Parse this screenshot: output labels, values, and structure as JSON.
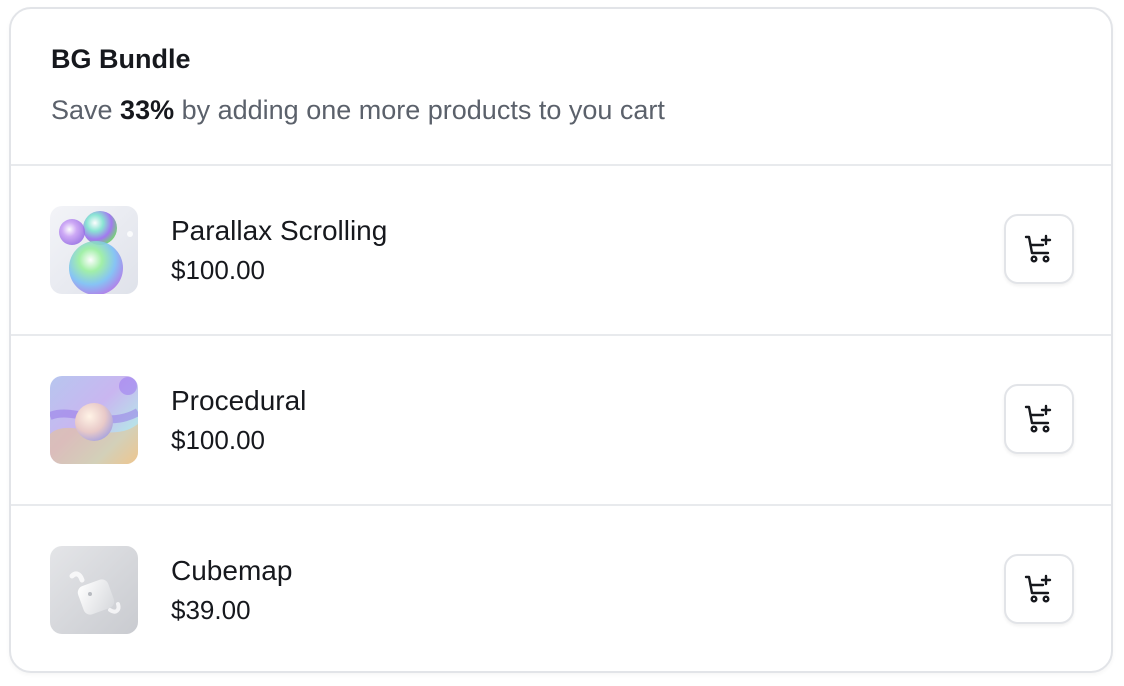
{
  "bundle": {
    "title": "BG Bundle",
    "subtitle_prefix": "Save ",
    "discount": "33%",
    "subtitle_suffix": " by adding one more products to you cart"
  },
  "products": [
    {
      "name": "Parallax Scrolling",
      "price": "$100.00",
      "thumbnail": "iridescent-bubbles",
      "action_icon": "cart-plus-icon"
    },
    {
      "name": "Procedural",
      "price": "$100.00",
      "thumbnail": "pastel-sphere",
      "action_icon": "cart-plus-icon"
    },
    {
      "name": "Cubemap",
      "price": "$39.00",
      "thumbnail": "white-earbuds-case",
      "action_icon": "cart-plus-icon"
    }
  ]
}
